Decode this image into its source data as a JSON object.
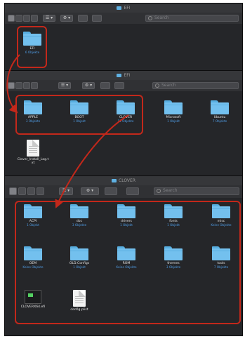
{
  "windows": {
    "w1": {
      "title": "EFI",
      "search_placeholder": "Search",
      "view_menu_glyph": "☰ ▾",
      "action_glyph": "⚙ ▾"
    },
    "w2": {
      "title": "EFI",
      "search_placeholder": "Search",
      "view_menu_glyph": "☰ ▾",
      "action_glyph": "⚙ ▾"
    },
    "w3": {
      "title": "CLOVER",
      "search_placeholder": "Search",
      "view_menu_glyph": "☰ ▾",
      "action_glyph": "⚙ ▾"
    }
  },
  "w1_items": [
    {
      "name": "EFI",
      "sub": "6 Objekte",
      "kind": "folder"
    }
  ],
  "w2_items": [
    {
      "name": "APPLE",
      "sub": "3 Objekte",
      "kind": "folder"
    },
    {
      "name": "BOOT",
      "sub": "1 Objekt",
      "kind": "folder"
    },
    {
      "name": "CLOVER",
      "sub": "11 Objekte",
      "kind": "folder"
    },
    {
      "name": "Microsoft",
      "sub": "1 Objekt",
      "kind": "folder"
    },
    {
      "name": "Ubuntu",
      "sub": "7 Objekte",
      "kind": "folder"
    },
    {
      "name": "Clover_Install_Log.t",
      "name2": "xt",
      "sub": "",
      "kind": "doc"
    }
  ],
  "w3_items": [
    {
      "name": "ACPI",
      "sub": "1 Objekt",
      "kind": "folder"
    },
    {
      "name": "doc",
      "sub": "3 Objekte",
      "kind": "folder"
    },
    {
      "name": "drivers",
      "sub": "1 Objekt",
      "kind": "folder"
    },
    {
      "name": "fonts",
      "sub": "1 Objekt",
      "kind": "folder"
    },
    {
      "name": "misc",
      "sub": "Keine Objekte",
      "kind": "folder"
    },
    {
      "name": "OEM",
      "sub": "Keine Objekte",
      "kind": "folder"
    },
    {
      "name": "OLD.Configs",
      "sub": "1 Objekt",
      "kind": "folder"
    },
    {
      "name": "ROM",
      "sub": "Keine Objekte",
      "kind": "folder"
    },
    {
      "name": "themes",
      "sub": "3 Objekte",
      "kind": "folder"
    },
    {
      "name": "tools",
      "sub": "7 Objekte",
      "kind": "folder"
    },
    {
      "name": "CLOVERX64.efi",
      "sub": "",
      "kind": "efi"
    },
    {
      "name": "config.plist",
      "sub": "",
      "kind": "doc"
    }
  ],
  "colors": {
    "highlight": "#c3281b",
    "folder": "#73c0ee",
    "subtitle": "#4f9de6",
    "window": "#252629"
  }
}
